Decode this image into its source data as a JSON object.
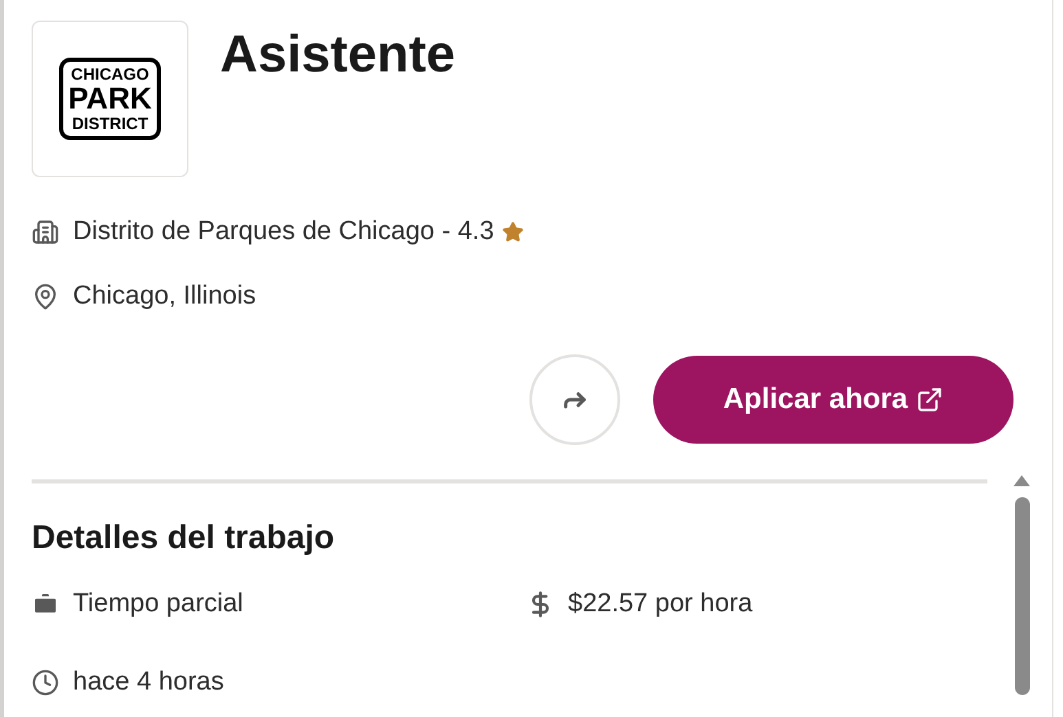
{
  "job": {
    "logo_lines": [
      "CHICAGO",
      "PARK",
      "DISTRICT"
    ],
    "title": "Asistente",
    "company": "Distrito de Parques de Chicago - 4.3",
    "location": "Chicago, Illinois",
    "apply_button": "Aplicar ahora"
  },
  "details": {
    "heading": "Detalles del trabajo",
    "items": [
      {
        "kind": "type",
        "text": "Tiempo parcial"
      },
      {
        "kind": "pay",
        "text": "$22.57 por hora"
      },
      {
        "kind": "posted",
        "text": "hace 4 horas"
      }
    ]
  }
}
